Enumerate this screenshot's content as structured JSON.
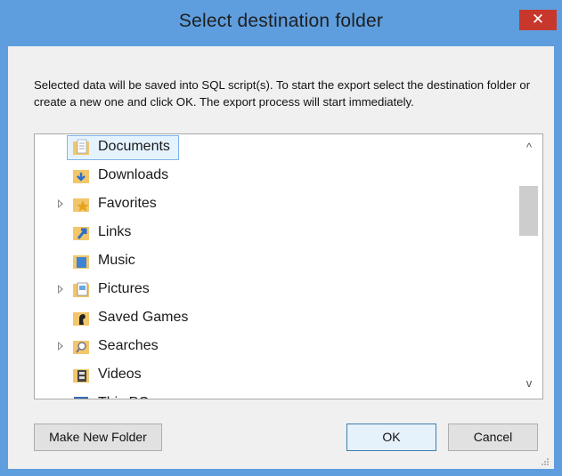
{
  "dialog": {
    "title": "Select destination folder",
    "close_glyph": "✕",
    "description": "Selected data will be saved into SQL script(s). To start the export select the destination folder or create a new one and click OK. The export process will start immediately."
  },
  "tree": {
    "items": [
      {
        "label": "Documents",
        "icon": "documents-folder-icon",
        "has_expander": false,
        "selected": true
      },
      {
        "label": "Downloads",
        "icon": "downloads-folder-icon",
        "has_expander": false,
        "selected": false
      },
      {
        "label": "Favorites",
        "icon": "favorites-folder-icon",
        "has_expander": true,
        "selected": false
      },
      {
        "label": "Links",
        "icon": "links-folder-icon",
        "has_expander": false,
        "selected": false
      },
      {
        "label": "Music",
        "icon": "music-folder-icon",
        "has_expander": false,
        "selected": false
      },
      {
        "label": "Pictures",
        "icon": "pictures-folder-icon",
        "has_expander": true,
        "selected": false
      },
      {
        "label": "Saved Games",
        "icon": "saved-games-folder-icon",
        "has_expander": false,
        "selected": false
      },
      {
        "label": "Searches",
        "icon": "searches-folder-icon",
        "has_expander": true,
        "selected": false
      },
      {
        "label": "Videos",
        "icon": "videos-folder-icon",
        "has_expander": false,
        "selected": false
      },
      {
        "label": "This PC",
        "icon": "this-pc-icon",
        "has_expander": false,
        "selected": false
      }
    ]
  },
  "scrollbar": {
    "up_glyph": "^",
    "down_glyph": "v"
  },
  "buttons": {
    "make_new_folder": "Make New Folder",
    "ok": "OK",
    "cancel": "Cancel"
  },
  "colors": {
    "titlebar": "#5e9ede",
    "close": "#c7372c",
    "selection": "#e5f3ff",
    "selection_border": "#7eb4ea",
    "folder": "#f2c66b"
  }
}
